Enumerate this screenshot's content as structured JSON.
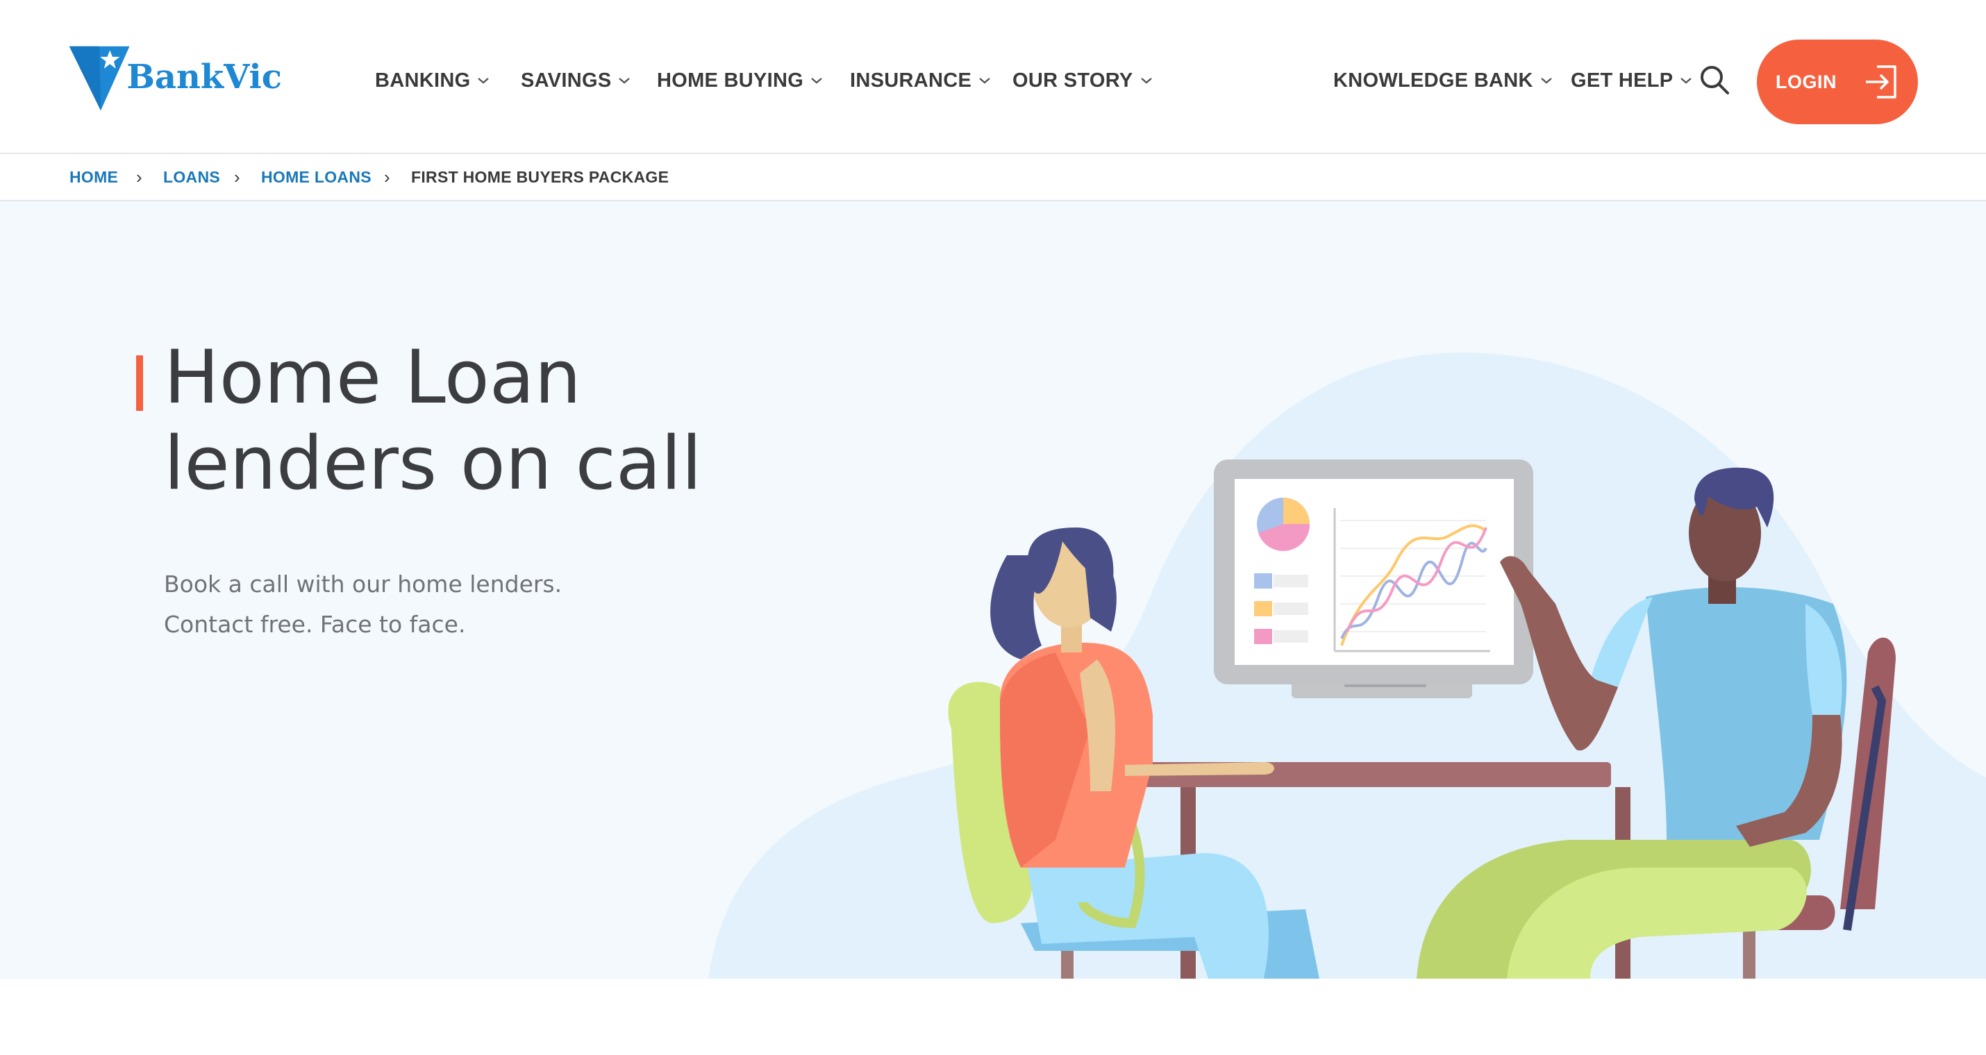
{
  "brand": {
    "name": "BankVic",
    "primary_color": "#1e88d4",
    "accent_color": "#f5613f"
  },
  "nav": {
    "items": [
      {
        "label": "BANKING"
      },
      {
        "label": "SAVINGS"
      },
      {
        "label": "HOME BUYING"
      },
      {
        "label": "INSURANCE"
      },
      {
        "label": "OUR STORY"
      },
      {
        "label": "KNOWLEDGE BANK"
      },
      {
        "label": "GET HELP"
      }
    ],
    "search_icon": "search-icon",
    "login_label": "LOGIN",
    "login_icon": "login-arrow-icon"
  },
  "breadcrumb": {
    "items": [
      {
        "label": "HOME"
      },
      {
        "label": "LOANS"
      },
      {
        "label": "HOME LOANS"
      },
      {
        "label": "FIRST HOME BUYERS PACKAGE"
      }
    ],
    "separator": "›"
  },
  "hero": {
    "title_line1": "Home Loan",
    "title_line2": "lenders on call",
    "sub_line1": "Book a call with our home lenders.",
    "sub_line2": "Contact free. Face to face.",
    "background_color": "#f4f9fd"
  }
}
